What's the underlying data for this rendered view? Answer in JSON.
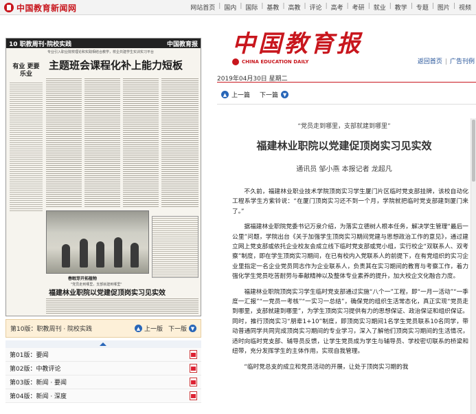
{
  "site": {
    "logo_text": "中国教育新闻网",
    "nav": [
      "网站首页",
      "国内",
      "国际",
      "基教",
      "高教",
      "评论",
      "高考",
      "考研",
      "就业",
      "教学",
      "专题",
      "图片",
      "视频"
    ]
  },
  "newspaper_page": {
    "header_left": "10 职教周刊·院校实践",
    "header_right": "中国教育报",
    "tagline": "专业引入职业院校理论和实践相结合教学，校企共建学生实训实习平台",
    "headline": "主题班会课程化补上能力短板",
    "side_heading": "有业 更要乐业",
    "photo_caption": "春眠芽开拓植物",
    "bottom_tagline": "\"党员走到哪里，支部就建到哪里\"",
    "bottom_headline": "福建林业职院以党建促顶岗实习见实效"
  },
  "page_bar": {
    "current": "第10版：职教周刊 · 院校实践",
    "prev_label": "上一版",
    "next_label": "下一版"
  },
  "editions": [
    {
      "label": "第01版：要闻"
    },
    {
      "label": "第02版：中教评论"
    },
    {
      "label": "第03版：新闻 · 要闻"
    },
    {
      "label": "第04版：新闻 · 深度"
    }
  ],
  "masthead": {
    "title": "中国教育报",
    "subtitle": "CHINA EDUCATION DAILY"
  },
  "right_links": {
    "home": "返回首页",
    "ad": "广告刊例"
  },
  "date": "2019年04月30日 星期二",
  "article_nav": {
    "prev": "上一篇",
    "next": "下一篇"
  },
  "article": {
    "intro": "“党员走到哪里，支部就建到哪里”",
    "title": "福建林业职院以党建促顶岗实习见实效",
    "author": "通讯员 邹小燕 本报记者 龙超凡",
    "paragraphs": [
      "不久前，福建林业职业技术学院顶岗实习学生厦门片区临时党支部挂牌，该校自动化工程系学生方紫铃说：“在厦门顶岗实习还不到一个月，学院就把临时党支部建到厦门来了。”",
      "据福建林业职院党委书记万泉介绍，为落实立德树人根本任务，解决学生管理“最后一公里”问题，学院出台《关于加强学生顶岗实习期间党建与思想政治工作的意见》，通过建立网上党支部或依托企业校友会成立线下临时党支部或党小组，实行校企“双联系人、双考察”制度，即在学生顶岗实习期间，在已有校内入党联系人的前提下，在有党组织的实习企业里指定一名企业党员同志作为企业联系人，负责其在实习期间的教育与考察工作，着力强化学生党员吃苦耐劳与奉献精神以及整体专业素养的提升，加大校企文化融合力度。",
      "福建林业职院顶岗实习学生临时党支部通过实施“八个一”工程，即“一月一活动”“一季度一汇报”“一党员一考核”“一实习一总结”，确保党的组织生活常态化，真正实现“党员走到哪里，支部就建到哪里”，为学生顶岗实习提供有力的思想保证、政治保证和组织保证。同时，推行顶岗实习“朋辈1+10”制度，即顶岗实习期间1名学生党员联系10名同学，带动普通同学共同完成顶岗实习期间的专业学习，深入了解他们顶岗实习期间的生活情况，适时向临时党支部、辅导员反馈，让学生党员成为学生与辅导员、学校密切联系的桥梁和纽带，充分发挥学生的主体作用，实现自我管理。",
      "“临时党总支的成立和党员活动的开展，让处于顶岗实习期的我"
    ]
  },
  "colors": {
    "brand_red": "#c8161d",
    "link_blue": "#1e4e96",
    "button_blue": "#2866b8",
    "page_bar_bg": "#fdf0d8"
  }
}
